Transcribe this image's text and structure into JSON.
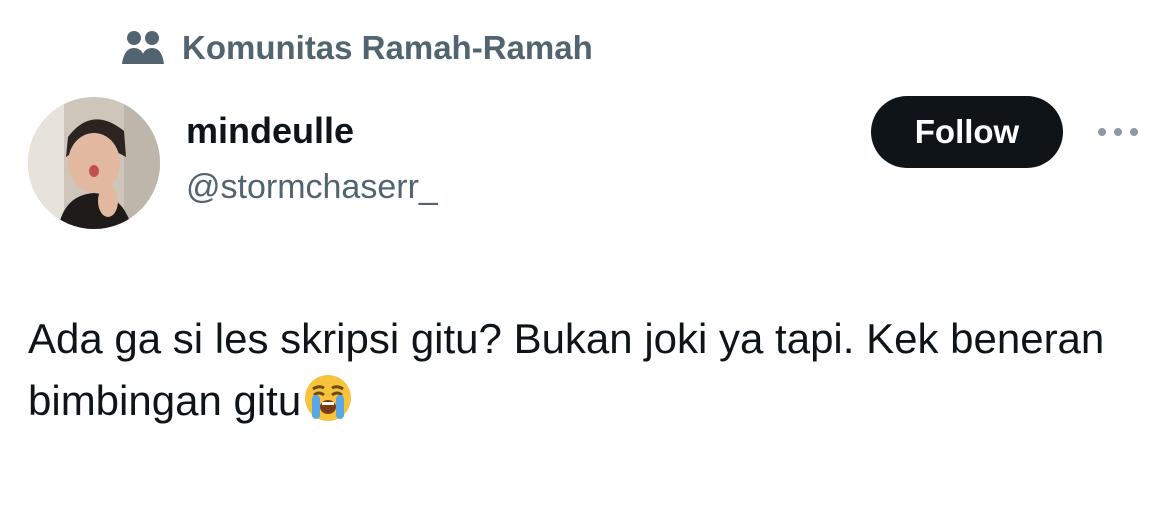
{
  "community": {
    "name": "Komunitas Ramah-Ramah",
    "icon": "community-icon"
  },
  "author": {
    "display_name": "mindeulle",
    "handle": "@stormchaserr_",
    "avatar": "avatar-photo"
  },
  "actions": {
    "follow_label": "Follow",
    "more_icon": "more-horizontal-icon"
  },
  "tweet": {
    "text": "Ada ga si les skripsi gitu? Bukan joki ya tapi. Kek beneran bimbingan gitu",
    "emoji": "loudly-crying-face-emoji"
  },
  "colors": {
    "primary_text": "#0f1419",
    "secondary_text": "#536471",
    "follow_bg": "#0f1419",
    "follow_text": "#ffffff"
  }
}
